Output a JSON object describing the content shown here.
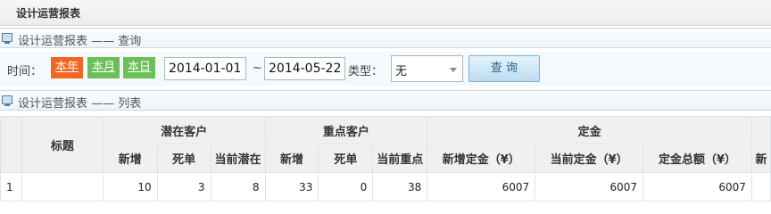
{
  "page_title": "设计运营报表",
  "query_section": {
    "title": "设计运营报表 —— 查询"
  },
  "list_section": {
    "title": "设计运营报表 —— 列表"
  },
  "filter": {
    "time_label": "时间：",
    "quick": [
      "本年",
      "本月",
      "本日"
    ],
    "active_quick": "本年",
    "start_date": "2014-01-01",
    "sep": "~",
    "end_date": "2014-05-22",
    "type_label": "类型：",
    "type_value": "无",
    "search_label": "查 询"
  },
  "table": {
    "title_header": "标题",
    "groups": [
      "潜在客户",
      "重点客户",
      "定金"
    ],
    "subheaders": [
      "新增",
      "死单",
      "当前潜在",
      "新增",
      "死单",
      "当前重点",
      "新增定金（¥）",
      "当前定金（¥）",
      "定金总额（¥）",
      "新"
    ],
    "rows": [
      {
        "index": "1",
        "title": "",
        "cells": [
          "10",
          "3",
          "8",
          "33",
          "0",
          "38",
          "6007",
          "6007",
          "6007",
          ""
        ]
      }
    ]
  },
  "colors": {
    "active": "#f26522",
    "quick": "#6bbf59",
    "header_bg": "#f0f0f0"
  }
}
